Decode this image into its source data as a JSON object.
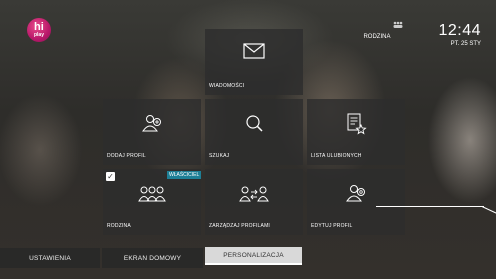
{
  "header": {
    "logo_text": "hi",
    "logo_sub": "play",
    "profile_name": "RODZINA",
    "time": "12:44",
    "date": "PT. 25 STY"
  },
  "tiles": [
    {
      "label": "WIADOMOŚCI",
      "icon": "envelope-icon"
    },
    {
      "label": "DODAJ PROFIL",
      "icon": "add-profile-icon"
    },
    {
      "label": "SZUKAJ",
      "icon": "search-icon"
    },
    {
      "label": "LISTA ULUBIONYCH",
      "icon": "favorites-list-icon"
    },
    {
      "label": "RODZINA",
      "icon": "family-icon"
    },
    {
      "label": "ZARZĄDZAJ PROFILAMI",
      "icon": "manage-profiles-icon"
    },
    {
      "label": "EDYTUJ PROFIL",
      "icon": "edit-profile-icon"
    }
  ],
  "owner_badge": "WŁAŚCICIEL",
  "tabs": [
    {
      "label": "USTAWIENIA",
      "active": false
    },
    {
      "label": "EKRAN DOMOWY",
      "active": false
    },
    {
      "label": "PERSONALIZACJA",
      "active": true
    }
  ]
}
